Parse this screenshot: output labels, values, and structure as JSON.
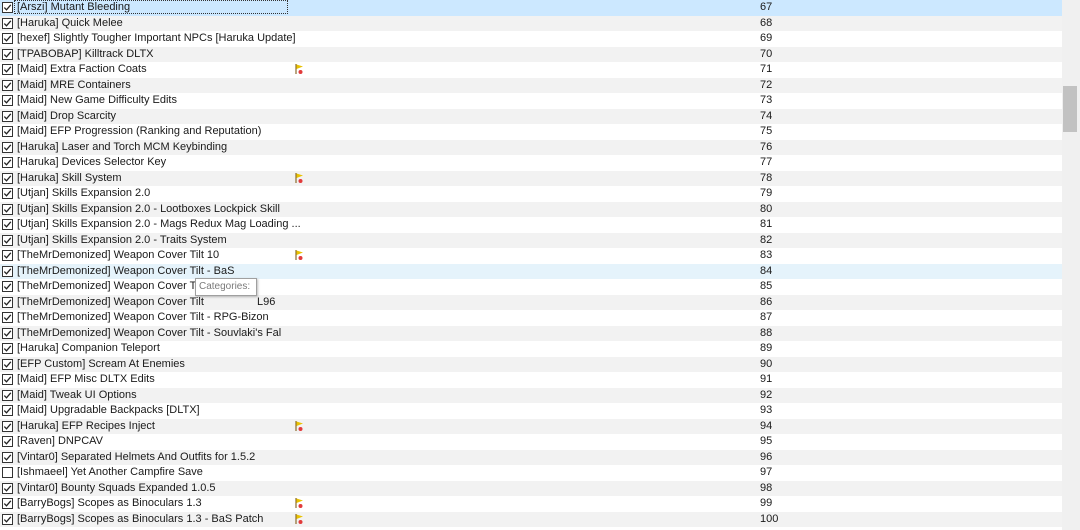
{
  "colors": {
    "row_alt": "#f2f2f2",
    "row_selected": "#cce8ff",
    "row_hover": "#e5f3fb",
    "scrollbar_thumb": "#c2c2c2",
    "flag_icon": "#e9c200"
  },
  "tooltip": {
    "label": "Categories:"
  },
  "mods": [
    {
      "name": "[Arszi] Mutant Bleeding",
      "priority": "67",
      "checked": true,
      "flag": false
    },
    {
      "name": "[Haruka] Quick Melee",
      "priority": "68",
      "checked": true,
      "flag": false
    },
    {
      "name": "[hexef] Slightly Tougher Important NPCs [Haruka Update]",
      "priority": "69",
      "checked": true,
      "flag": false
    },
    {
      "name": "[TPABOBAP] Killtrack DLTX",
      "priority": "70",
      "checked": true,
      "flag": false
    },
    {
      "name": "[Maid] Extra Faction Coats",
      "priority": "71",
      "checked": true,
      "flag": true
    },
    {
      "name": "[Maid] MRE Containers",
      "priority": "72",
      "checked": true,
      "flag": false
    },
    {
      "name": "[Maid] New Game Difficulty Edits",
      "priority": "73",
      "checked": true,
      "flag": false
    },
    {
      "name": "[Maid] Drop Scarcity",
      "priority": "74",
      "checked": true,
      "flag": false
    },
    {
      "name": "[Maid] EFP Progression (Ranking and Reputation)",
      "priority": "75",
      "checked": true,
      "flag": false
    },
    {
      "name": "[Haruka] Laser and Torch MCM Keybinding",
      "priority": "76",
      "checked": true,
      "flag": false
    },
    {
      "name": "[Haruka] Devices Selector Key",
      "priority": "77",
      "checked": true,
      "flag": false
    },
    {
      "name": "[Haruka] Skill System",
      "priority": "78",
      "checked": true,
      "flag": true
    },
    {
      "name": "[Utjan] Skills Expansion 2.0",
      "priority": "79",
      "checked": true,
      "flag": false
    },
    {
      "name": "[Utjan] Skills Expansion 2.0 - Lootboxes Lockpick Skill",
      "priority": "80",
      "checked": true,
      "flag": false
    },
    {
      "name": "[Utjan] Skills Expansion 2.0 - Mags Redux Mag Loading ...",
      "priority": "81",
      "checked": true,
      "flag": false
    },
    {
      "name": "[Utjan] Skills Expansion 2.0 - Traits System",
      "priority": "82",
      "checked": true,
      "flag": false
    },
    {
      "name": "[TheMrDemonized] Weapon Cover Tilt 10",
      "priority": "83",
      "checked": true,
      "flag": true
    },
    {
      "name": "[TheMrDemonized] Weapon Cover Tilt - BaS",
      "priority": "84",
      "checked": true,
      "flag": false
    },
    {
      "name": "[TheMrDemonized] Weapon Cover Tilt",
      "priority": "85",
      "checked": true,
      "flag": false
    },
    {
      "name": "[TheMrDemonized] Weapon Cover Tilt",
      "suffix": "L96",
      "priority": "86",
      "checked": true,
      "flag": false
    },
    {
      "name": "[TheMrDemonized] Weapon Cover Tilt - RPG-Bizon",
      "priority": "87",
      "checked": true,
      "flag": false
    },
    {
      "name": "[TheMrDemonized] Weapon Cover Tilt - Souvlaki's Fal",
      "priority": "88",
      "checked": true,
      "flag": false
    },
    {
      "name": "[Haruka] Companion Teleport",
      "priority": "89",
      "checked": true,
      "flag": false
    },
    {
      "name": "[EFP Custom] Scream At Enemies",
      "priority": "90",
      "checked": true,
      "flag": false
    },
    {
      "name": "[Maid] EFP Misc DLTX Edits",
      "priority": "91",
      "checked": true,
      "flag": false
    },
    {
      "name": "[Maid] Tweak UI Options",
      "priority": "92",
      "checked": true,
      "flag": false
    },
    {
      "name": "[Maid] Upgradable Backpacks [DLTX]",
      "priority": "93",
      "checked": true,
      "flag": false
    },
    {
      "name": "[Haruka] EFP Recipes Inject",
      "priority": "94",
      "checked": true,
      "flag": true
    },
    {
      "name": "[Raven] DNPCAV",
      "priority": "95",
      "checked": true,
      "flag": false
    },
    {
      "name": "[Vintar0] Separated Helmets And Outfits for 1.5.2",
      "priority": "96",
      "checked": true,
      "flag": false
    },
    {
      "name": "[Ishmaeel] Yet Another Campfire Save",
      "priority": "97",
      "checked": false,
      "flag": false
    },
    {
      "name": "[Vintar0] Bounty Squads Expanded 1.0.5",
      "priority": "98",
      "checked": true,
      "flag": false
    },
    {
      "name": "[BarryBogs] Scopes as Binoculars 1.3",
      "priority": "99",
      "checked": true,
      "flag": true
    },
    {
      "name": "[BarryBogs] Scopes as Binoculars 1.3 - BaS Patch",
      "priority": "100",
      "checked": true,
      "flag": true
    }
  ]
}
